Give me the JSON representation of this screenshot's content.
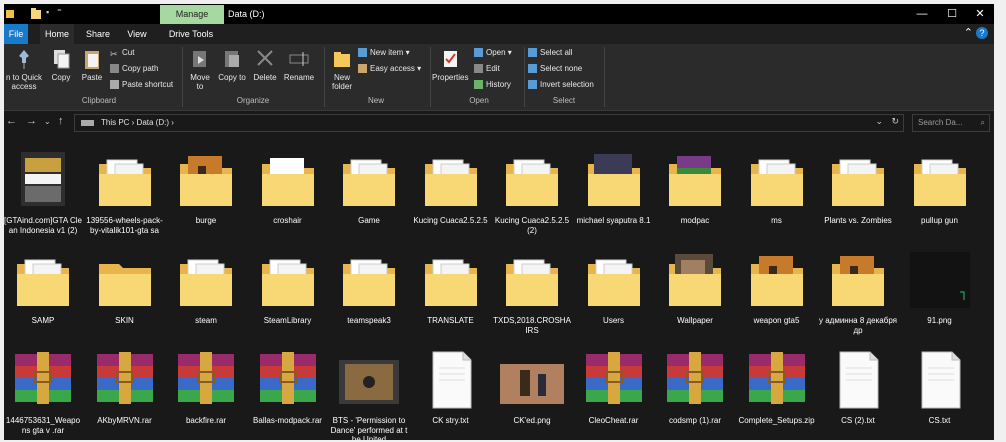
{
  "titlebar": {
    "manage_label": "Manage",
    "title": "Data (D:)",
    "minimize_icon": "minimize-icon",
    "maximize_icon": "maximize-icon",
    "close_icon": "close-icon"
  },
  "tabs": [
    {
      "label": "File"
    },
    {
      "label": "Home"
    },
    {
      "label": "Share"
    },
    {
      "label": "View"
    },
    {
      "label": "Drive Tools"
    }
  ],
  "ribbon": {
    "clipboard": {
      "pin_label": "n to Quick access",
      "copy_label": "Copy",
      "paste_label": "Paste",
      "cut_label": "Cut",
      "copy_path_label": "Copy path",
      "paste_shortcut_label": "Paste shortcut",
      "group_label": "Clipboard"
    },
    "organize": {
      "move_to_label": "Move to",
      "copy_to_label": "Copy to",
      "delete_label": "Delete",
      "rename_label": "Rename",
      "group_label": "Organize"
    },
    "new": {
      "new_folder_label": "New folder",
      "new_item_label": "New item",
      "easy_access_label": "Easy access",
      "group_label": "New"
    },
    "open": {
      "properties_label": "Properties",
      "open_label": "Open",
      "edit_label": "Edit",
      "history_label": "History",
      "group_label": "Open"
    },
    "select": {
      "select_all_label": "Select all",
      "select_none_label": "Select none",
      "invert_label": "Invert selection",
      "group_label": "Select"
    }
  },
  "address": {
    "path": [
      "This PC",
      "Data (D:)"
    ],
    "path_text": "This PC  ›  Data (D:)  ›",
    "search_placeholder": "Search Da..."
  },
  "items": [
    {
      "name": "[GTAind.com]GTA Clean Indonesia v1 (2)",
      "type": "folder-gta"
    },
    {
      "name": "139556-wheels-pack-by-vitalik101-gta sa",
      "type": "folder-docs"
    },
    {
      "name": "burge",
      "type": "folder-soldier"
    },
    {
      "name": "croshair",
      "type": "folder-croshair"
    },
    {
      "name": "Game",
      "type": "folder-docs"
    },
    {
      "name": "Kucing Cuaca2.5.2.5",
      "type": "folder-docs"
    },
    {
      "name": "Kucing Cuaca2.5.2.5 (2)",
      "type": "folder-docs"
    },
    {
      "name": "michael syaputra 8.1",
      "type": "folder-dark"
    },
    {
      "name": "modpac",
      "type": "folder-rar"
    },
    {
      "name": "ms",
      "type": "folder-docs"
    },
    {
      "name": "Plants vs. Zombies",
      "type": "folder-docs"
    },
    {
      "name": "pullup gun",
      "type": "folder-docs"
    },
    {
      "name": "SAMP",
      "type": "folder-docs"
    },
    {
      "name": "SKIN",
      "type": "folder-plain"
    },
    {
      "name": "steam",
      "type": "folder-docs"
    },
    {
      "name": "SteamLibrary",
      "type": "folder-docs"
    },
    {
      "name": "teamspeak3",
      "type": "folder-docs"
    },
    {
      "name": "TRANSLATE",
      "type": "folder-docs"
    },
    {
      "name": "TXDS,2018.CROSHAIRS",
      "type": "folder-docs"
    },
    {
      "name": "Users",
      "type": "folder-docs"
    },
    {
      "name": "Wallpaper",
      "type": "folder-wallpaper"
    },
    {
      "name": "weapon gta5",
      "type": "folder-soldier"
    },
    {
      "name": "у админна 8 декабря др",
      "type": "folder-soldier"
    },
    {
      "name": "91.png",
      "type": "image-dark"
    },
    {
      "name": "1446753631_Weapons gta v .rar",
      "type": "rar"
    },
    {
      "name": "AKbyMRVN.rar",
      "type": "rar"
    },
    {
      "name": "backfire.rar",
      "type": "rar"
    },
    {
      "name": "Ballas-modpack.rar",
      "type": "rar"
    },
    {
      "name": "BTS - 'Permission to Dance' performed at the United",
      "type": "video"
    },
    {
      "name": "CK stry.txt",
      "type": "txt"
    },
    {
      "name": "CK'ed.png",
      "type": "image-photo"
    },
    {
      "name": "CleoCheat.rar",
      "type": "rar"
    },
    {
      "name": "codsmp (1).rar",
      "type": "rar"
    },
    {
      "name": "Complete_Setups.zip",
      "type": "rar"
    },
    {
      "name": "CS (2).txt",
      "type": "txt"
    },
    {
      "name": "CS.txt",
      "type": "txt"
    }
  ]
}
